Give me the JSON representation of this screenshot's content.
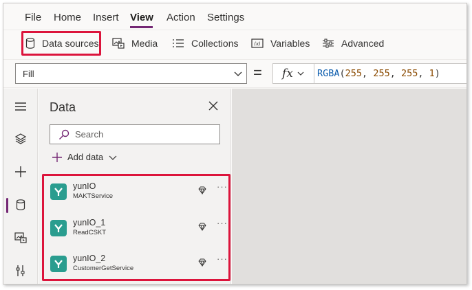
{
  "menu": {
    "items": [
      {
        "label": "File",
        "active": false
      },
      {
        "label": "Home",
        "active": false
      },
      {
        "label": "Insert",
        "active": false
      },
      {
        "label": "View",
        "active": true
      },
      {
        "label": "Action",
        "active": false
      },
      {
        "label": "Settings",
        "active": false
      }
    ]
  },
  "ribbon": {
    "buttons": [
      {
        "label": "Data sources",
        "icon": "database-icon",
        "highlighted": true
      },
      {
        "label": "Media",
        "icon": "media-icon"
      },
      {
        "label": "Collections",
        "icon": "collections-icon"
      },
      {
        "label": "Variables",
        "icon": "variables-icon"
      },
      {
        "label": "Advanced",
        "icon": "advanced-icon"
      }
    ]
  },
  "formula": {
    "property": "Fill",
    "equals": "=",
    "fx": "fx",
    "function": "RGBA",
    "open": "(",
    "args": [
      "255",
      "255",
      "255",
      "1"
    ],
    "close": ")"
  },
  "rail": {
    "items": [
      {
        "icon": "hamburger-menu-icon"
      },
      {
        "icon": "layers-icon"
      },
      {
        "icon": "plus-icon"
      },
      {
        "icon": "database-icon",
        "active": true
      },
      {
        "icon": "media-icon"
      },
      {
        "icon": "tools-icon"
      }
    ]
  },
  "pane": {
    "title": "Data",
    "search_placeholder": "Search",
    "add_data_label": "Add data",
    "sources": [
      {
        "name": "yunIO",
        "service": "MAKTService"
      },
      {
        "name": "yunIO_1",
        "service": "ReadCSKT"
      },
      {
        "name": "yunIO_2",
        "service": "CustomerGetService"
      }
    ],
    "more_label": "···"
  },
  "colors": {
    "accent": "#742774",
    "highlight": "#dc143c",
    "logo": "#2a9d8f"
  }
}
